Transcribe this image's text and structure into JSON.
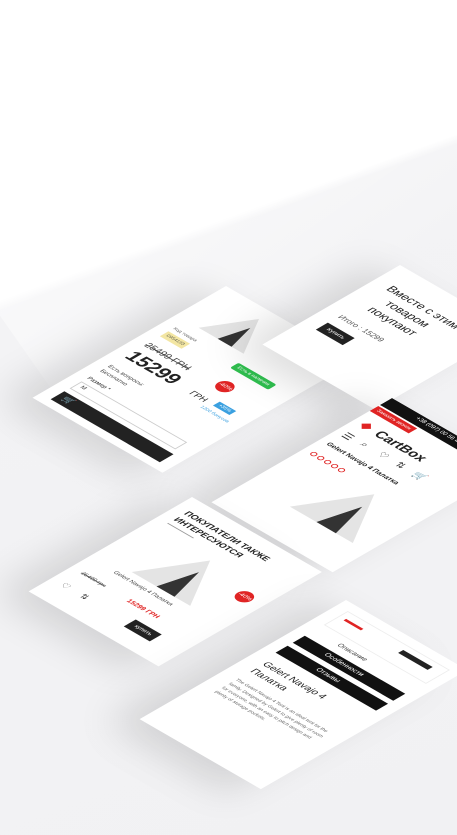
{
  "product_card": {
    "stock_label": "Есть в наличии",
    "code_label": "Код товара",
    "code_value": "0954193",
    "old_price": "25499 ГРН",
    "price": "15299",
    "currency": "ГРН",
    "discount": "-40%",
    "bonus_badge": "+35%",
    "bonus_text": "1200 бонусов",
    "questions_label": "Есть вопросы:",
    "free_label": "Бесплатно",
    "size_label": "Размер *",
    "size_value": "M"
  },
  "recommend_card": {
    "title_line1": "ПОКУПАТЕЛИ ТАКЖЕ",
    "title_line2": "ИНТЕРЕСУЮТСЯ",
    "product_name": "Gelert Navajo 4 Палатка",
    "old_price": "25499 грн",
    "new_price": "15299 ГРН",
    "discount": "-40%",
    "buy_label": "купить"
  },
  "together_card": {
    "line1": "Вместе с этим",
    "line2": "товаром",
    "line3": "покупают",
    "total_label": "Итого : 15299",
    "button_label": "Купить"
  },
  "cartbox_card": {
    "phone": "+38 (097) 00 56 4...",
    "callback_label": "Заказать звонок",
    "brand": "CartBox",
    "product_title": "Gelert Navajo 4 Палатка"
  },
  "tabs_card": {
    "tab_description": "Описание",
    "tab_features": "Особенности",
    "tab_reviews": "Отзывы",
    "product_title_line1": "Gelert Navajo 4",
    "product_title_line2": "Палатка",
    "description_text": "The Gelert Navajo 4 Tent is an ideal tent for the family. Designed by Gelert to give plenty of room for everyone, with an easy to pitch design and plenty of storage pockets."
  }
}
